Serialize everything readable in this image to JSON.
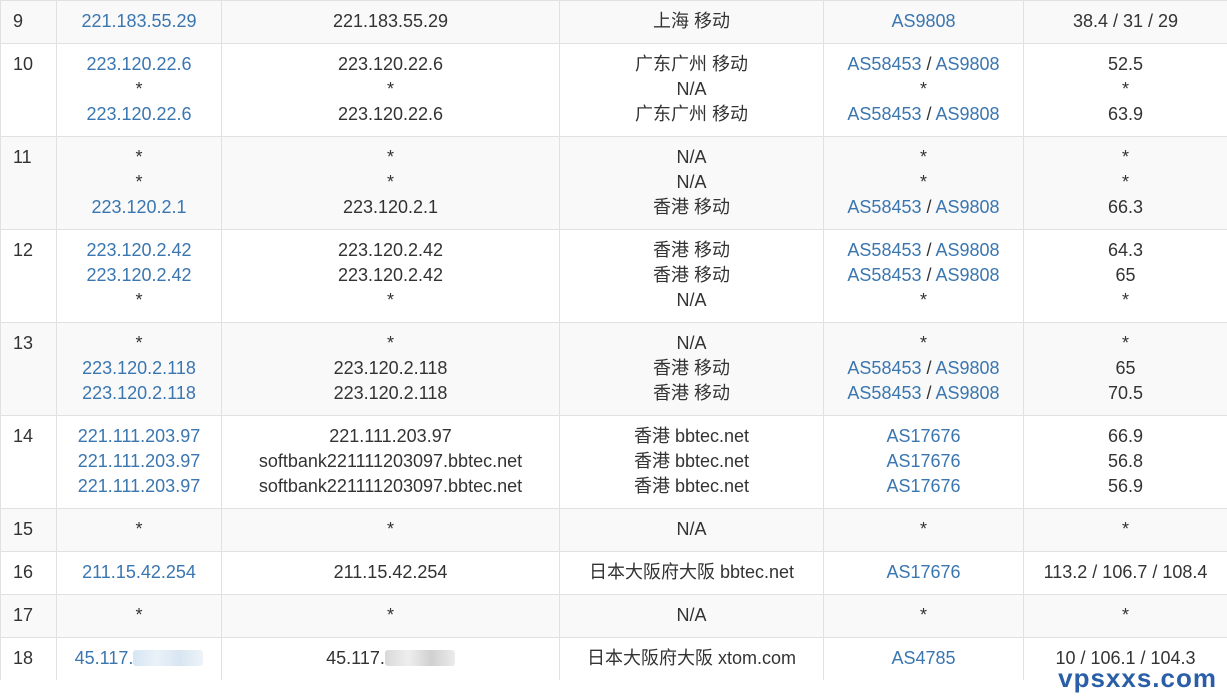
{
  "rows": [
    {
      "hop": "9",
      "ip": [
        "221.183.55.29"
      ],
      "host": [
        "221.183.55.29"
      ],
      "loc": [
        "上海 移动"
      ],
      "asn": [
        [
          "AS9808"
        ]
      ],
      "rtt": [
        "38.4 / 31 / 29"
      ]
    },
    {
      "hop": "10",
      "ip": [
        "223.120.22.6",
        "*",
        "223.120.22.6"
      ],
      "host": [
        "223.120.22.6",
        "*",
        "223.120.22.6"
      ],
      "loc": [
        "广东广州 移动",
        "N/A",
        "广东广州 移动"
      ],
      "asn": [
        [
          "AS58453",
          "AS9808"
        ],
        [
          "*"
        ],
        [
          "AS58453",
          "AS9808"
        ]
      ],
      "rtt": [
        "52.5",
        "*",
        "63.9"
      ]
    },
    {
      "hop": "11",
      "ip": [
        "*",
        "*",
        "223.120.2.1"
      ],
      "host": [
        "*",
        "*",
        "223.120.2.1"
      ],
      "loc": [
        "N/A",
        "N/A",
        "香港 移动"
      ],
      "asn": [
        [
          "*"
        ],
        [
          "*"
        ],
        [
          "AS58453",
          "AS9808"
        ]
      ],
      "rtt": [
        "*",
        "*",
        "66.3"
      ]
    },
    {
      "hop": "12",
      "ip": [
        "223.120.2.42",
        "223.120.2.42",
        "*"
      ],
      "host": [
        "223.120.2.42",
        "223.120.2.42",
        "*"
      ],
      "loc": [
        "香港 移动",
        "香港 移动",
        "N/A"
      ],
      "asn": [
        [
          "AS58453",
          "AS9808"
        ],
        [
          "AS58453",
          "AS9808"
        ],
        [
          "*"
        ]
      ],
      "rtt": [
        "64.3",
        "65",
        "*"
      ]
    },
    {
      "hop": "13",
      "ip": [
        "*",
        "223.120.2.118",
        "223.120.2.118"
      ],
      "host": [
        "*",
        "223.120.2.118",
        "223.120.2.118"
      ],
      "loc": [
        "N/A",
        "香港 移动",
        "香港 移动"
      ],
      "asn": [
        [
          "*"
        ],
        [
          "AS58453",
          "AS9808"
        ],
        [
          "AS58453",
          "AS9808"
        ]
      ],
      "rtt": [
        "*",
        "65",
        "70.5"
      ]
    },
    {
      "hop": "14",
      "ip": [
        "221.111.203.97",
        "221.111.203.97",
        "221.111.203.97"
      ],
      "host": [
        "221.111.203.97",
        "softbank221111203097.bbtec.net",
        "softbank221111203097.bbtec.net"
      ],
      "loc": [
        "香港 bbtec.net",
        "香港 bbtec.net",
        "香港 bbtec.net"
      ],
      "asn": [
        [
          "AS17676"
        ],
        [
          "AS17676"
        ],
        [
          "AS17676"
        ]
      ],
      "rtt": [
        "66.9",
        "56.8",
        "56.9"
      ]
    },
    {
      "hop": "15",
      "ip": [
        "*"
      ],
      "host": [
        "*"
      ],
      "loc": [
        "N/A"
      ],
      "asn": [
        [
          "*"
        ]
      ],
      "rtt": [
        "*"
      ]
    },
    {
      "hop": "16",
      "ip": [
        "211.15.42.254"
      ],
      "host": [
        "211.15.42.254"
      ],
      "loc": [
        "日本大阪府大阪 bbtec.net"
      ],
      "asn": [
        [
          "AS17676"
        ]
      ],
      "rtt": [
        "113.2 / 106.7 / 108.4"
      ]
    },
    {
      "hop": "17",
      "ip": [
        "*"
      ],
      "host": [
        "*"
      ],
      "loc": [
        "N/A"
      ],
      "asn": [
        [
          "*"
        ]
      ],
      "rtt": [
        "*"
      ]
    },
    {
      "hop": "18",
      "ip": [
        "45.117."
      ],
      "host": [
        "45.117."
      ],
      "loc": [
        "日本大阪府大阪 xtom.com"
      ],
      "asn": [
        [
          "AS4785"
        ]
      ],
      "rtt": [
        "10 / 106.1 / 104.3"
      ],
      "masked": true
    }
  ],
  "asn_separator": " / ",
  "watermark": "vpsxxs.com"
}
